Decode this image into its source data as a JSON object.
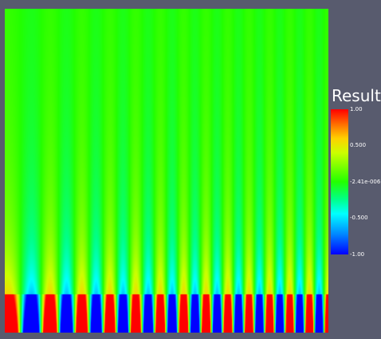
{
  "legend": {
    "title": "Result",
    "ticks": [
      "1.00",
      "0.500",
      "-2.41e-006",
      "-0.500",
      "-1.00"
    ]
  },
  "colors": {
    "background": "#585b6e",
    "max": "#ff0000",
    "mid": "#22ff00",
    "min": "#0000ff"
  }
}
